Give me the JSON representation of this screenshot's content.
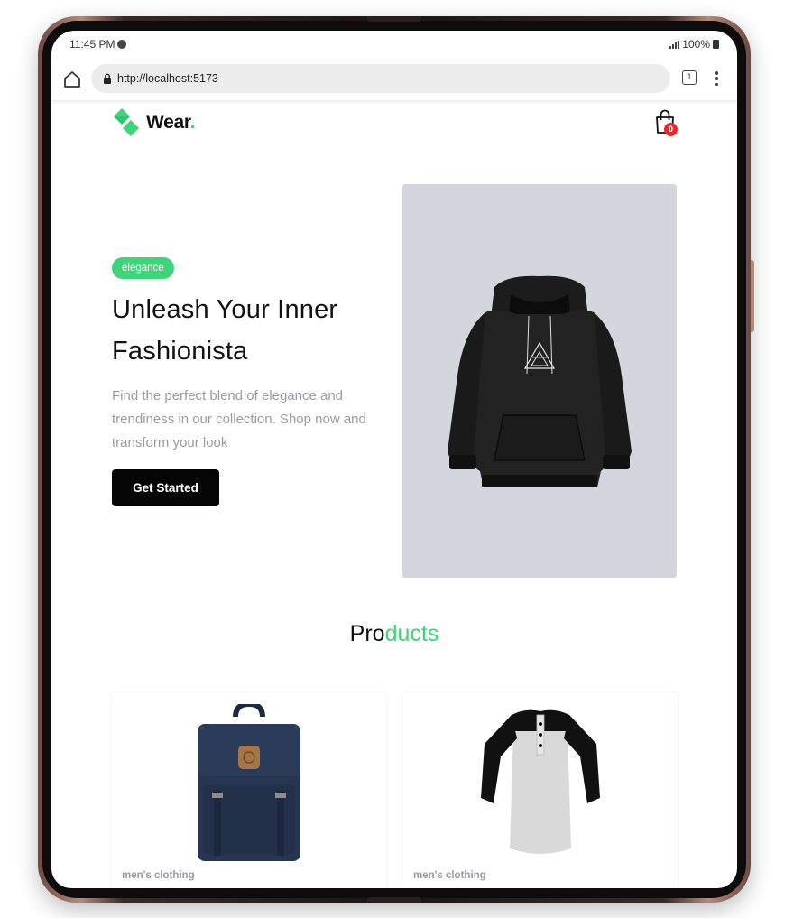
{
  "status_bar": {
    "time": "11:45 PM",
    "battery": "100%"
  },
  "browser": {
    "url": "http://localhost:5173",
    "tab_count": "1"
  },
  "header": {
    "logo_text": "Wear",
    "logo_dot": ".",
    "cart_count": "0"
  },
  "hero": {
    "badge": "elegance",
    "title": "Unleash Your Inner Fashionista",
    "description": "Find the perfect blend of elegance and trendiness in our collection. Shop now and transform your look",
    "cta_label": "Get Started"
  },
  "products_section": {
    "title_dark": "Pro",
    "title_accent": "ducts"
  },
  "products": [
    {
      "category": "men's clothing",
      "image": "navy-backpack"
    },
    {
      "category": "men's clothing",
      "image": "raglan-henley-shirt"
    }
  ],
  "colors": {
    "accent": "#3fd37a",
    "badge": "#e5262b",
    "hero_bg": "#d3d6dd",
    "button": "#050505",
    "muted_text": "#9a9aa5"
  }
}
